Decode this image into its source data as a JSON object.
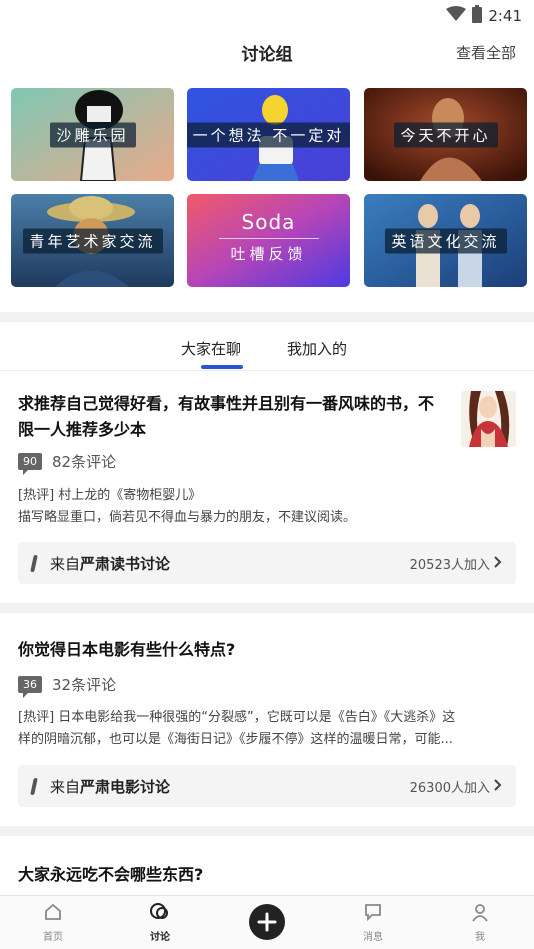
{
  "status": {
    "time": "2:41"
  },
  "header": {
    "title": "讨论组",
    "view_all": "查看全部"
  },
  "groups": [
    {
      "label": "沙雕乐园"
    },
    {
      "label": "一个想法 不一定对"
    },
    {
      "label": "今天不开心"
    },
    {
      "label": "青年艺术家交流"
    },
    {
      "title": "Soda",
      "label": "吐槽反馈"
    },
    {
      "label": "英语文化交流"
    }
  ],
  "tabs": [
    {
      "label": "大家在聊"
    },
    {
      "label": "我加入的"
    }
  ],
  "posts": [
    {
      "title_line1": "求推荐自己觉得好看，有故事性并且别有一番风味的书，不",
      "title_line2": "限一人推荐多少本",
      "badge": "90",
      "comments": "82条评论",
      "hot_line1": "[热评] 村上龙的《寄物柜婴儿》",
      "hot_line2": "描写略显重口，倘若见不得血与暴力的朋友，不建议阅读。",
      "source_prefix": "来自",
      "source_name": "严肃读书讨论",
      "joined": "20523人加入"
    },
    {
      "title_line1": "你觉得日本电影有些什么特点?",
      "badge": "36",
      "comments": "32条评论",
      "hot_line1": "[热评] 日本电影给我一种很强的“分裂感”，它既可以是《告白》《大逃杀》这",
      "hot_line2": "样的阴暗沉郁，也可以是《海街日记》《步履不停》这样的温暖日常，可能...",
      "source_prefix": "来自",
      "source_name": "严肃电影讨论",
      "joined": "26300人加入"
    },
    {
      "title_line1": "大家永远吃不会哪些东西?"
    }
  ],
  "tabbar": [
    {
      "label": "首页",
      "icon": "home-icon"
    },
    {
      "label": "讨论",
      "icon": "discussion-icon"
    },
    {
      "label": "",
      "icon": "plus-icon"
    },
    {
      "label": "消息",
      "icon": "message-icon"
    },
    {
      "label": "我",
      "icon": "profile-icon"
    }
  ]
}
